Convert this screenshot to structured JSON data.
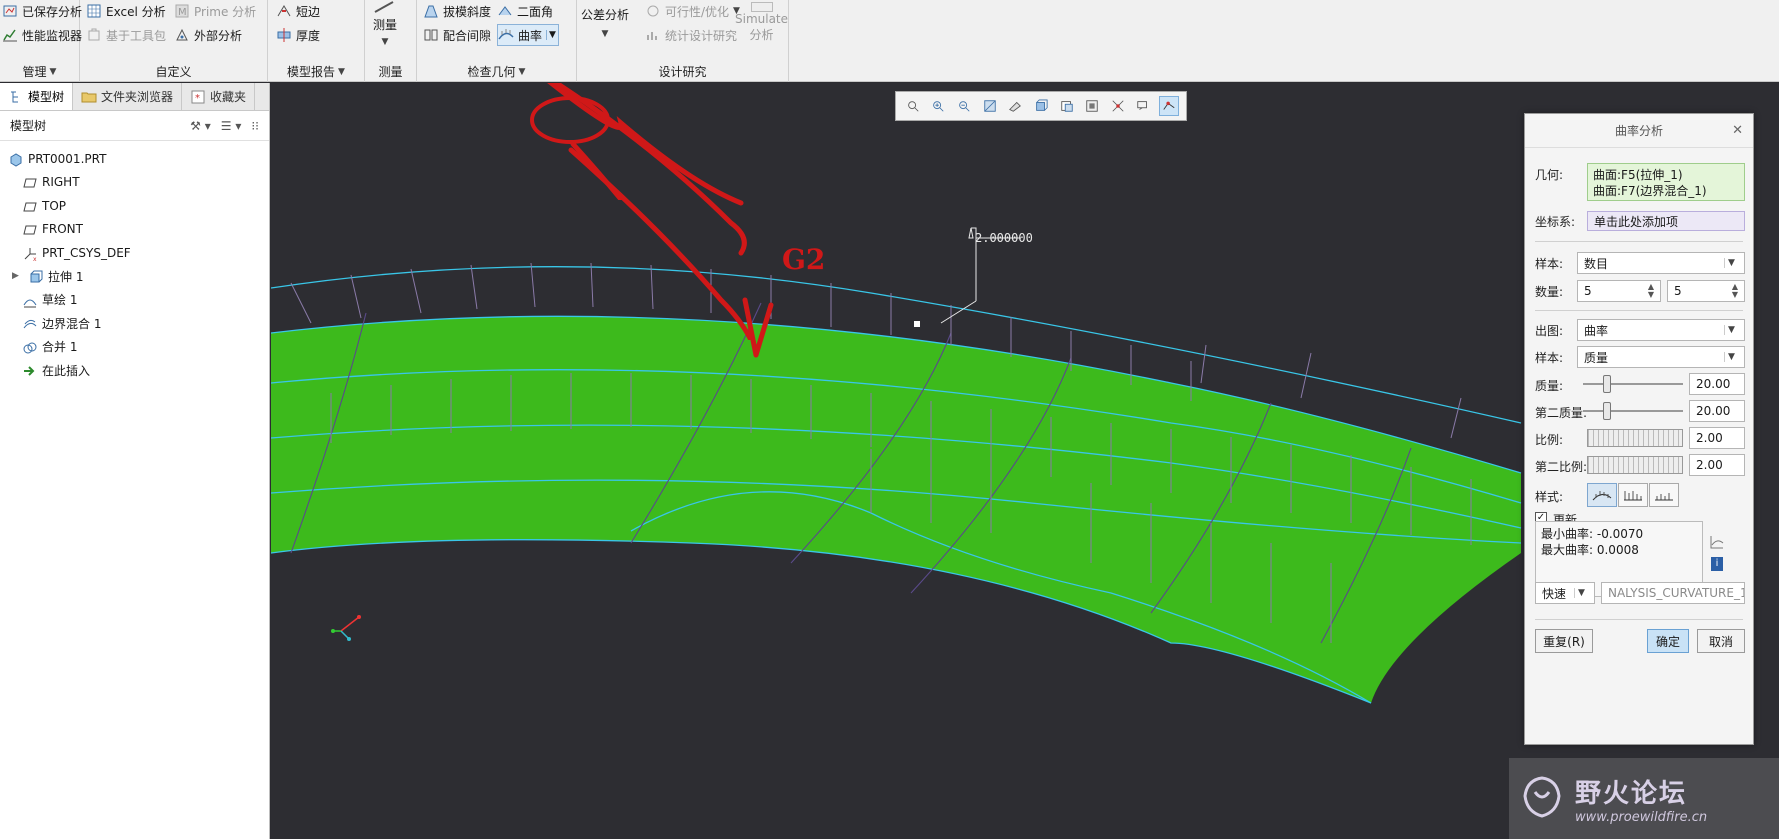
{
  "ribbon": {
    "groups": {
      "manage": {
        "title": "管理",
        "btn_saved": "已保存分析",
        "btn_perf": "性能监视器"
      },
      "custom": {
        "title": "自定义",
        "btn_excel": "Excel 分析",
        "btn_prime": "Prime 分析",
        "btn_toolkit": "基于工具包",
        "btn_external": "外部分析"
      },
      "model_report": {
        "title": "模型报告",
        "btn_short_edge": "短边",
        "btn_thickness": "厚度"
      },
      "measure": {
        "title": "测量",
        "btn_measure": "测量"
      },
      "inspect": {
        "title": "检查几何",
        "btn_draft": "拔模斜度",
        "btn_dihedral": "二面角",
        "btn_clearance": "配合间隙",
        "btn_curvature": "曲率"
      },
      "design_study": {
        "title": "设计研究",
        "btn_tolerance": "公差分析",
        "btn_feasibility": "可行性/优化",
        "btn_statistical": "统计设计研究",
        "btn_simulate_1": "Simulate",
        "btn_simulate_2": "分析"
      }
    }
  },
  "left_panel": {
    "tabs": [
      "模型树",
      "文件夹浏览器",
      "收藏夹"
    ],
    "tree_title": "模型树",
    "items": [
      {
        "label": "PRT0001.PRT",
        "icon": "part-icon"
      },
      {
        "label": "RIGHT",
        "icon": "plane-icon"
      },
      {
        "label": "TOP",
        "icon": "plane-icon"
      },
      {
        "label": "FRONT",
        "icon": "plane-icon"
      },
      {
        "label": "PRT_CSYS_DEF",
        "icon": "csys-icon"
      },
      {
        "label": "拉伸 1",
        "icon": "extrude-icon"
      },
      {
        "label": "草绘 1",
        "icon": "sketch-icon"
      },
      {
        "label": "边界混合 1",
        "icon": "boundary-blend-icon"
      },
      {
        "label": "合并 1",
        "icon": "merge-icon"
      },
      {
        "label": "在此插入",
        "icon": "insert-arrow-icon"
      }
    ]
  },
  "viewport": {
    "annotation_value": "2.000000",
    "handwritten_note": "G2"
  },
  "dialog": {
    "title": "曲率分析",
    "geometry_label": "几何:",
    "geometry_items": [
      "曲面:F5(拉伸_1)",
      "曲面:F7(边界混合_1)"
    ],
    "csys_label": "坐标系:",
    "csys_value": "单击此处添加项",
    "sample_label": "样本:",
    "sample_value": "数目",
    "count_label": "数量:",
    "count_u": "5",
    "count_v": "5",
    "output_label": "出图:",
    "output_value": "曲率",
    "sample2_label": "样本:",
    "sample2_value": "质量",
    "quality_label": "质量:",
    "quality_value": "20.00",
    "quality2_label": "第二质量:",
    "quality2_value": "20.00",
    "scale_label": "比例:",
    "scale_value": "2.00",
    "scale2_label": "第二比例:",
    "scale2_value": "2.00",
    "style_label": "样式:",
    "update_label": "更新",
    "min_curvature": "最小曲率: -0.0070",
    "max_curvature": "最大曲率: 0.0008",
    "mode_value": "快速",
    "name_value": "NALYSIS_CURVATURE_1",
    "repeat_btn": "重复(R)",
    "ok_btn": "确定",
    "cancel_btn": "取消"
  },
  "watermark": {
    "line1": "野火论坛",
    "line2": "www.proewildfire.cn"
  },
  "colors": {
    "surface": "#3dba1c",
    "curve": "#39c6e8",
    "comb": "#8a7aa8",
    "annotation_red": "#d01818",
    "background": "#2d2d32"
  }
}
